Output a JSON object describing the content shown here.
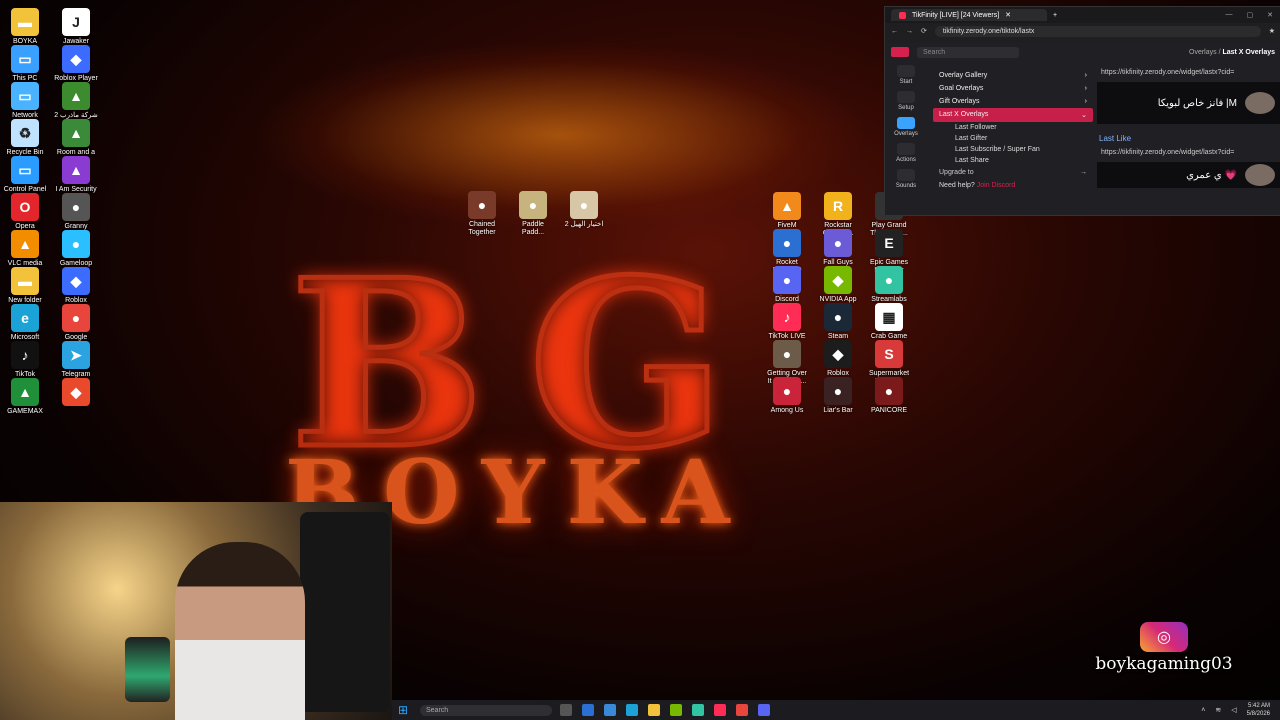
{
  "wallpaper": {
    "brand_letters": "BG",
    "brand_name": "BOYKA"
  },
  "desktop_icons_left": [
    {
      "label": "BOYKA",
      "color": "#f2c23b",
      "glyph": "▬"
    },
    {
      "label": "Jawaker",
      "color": "#ffffff",
      "glyph": "J"
    },
    {
      "label": "This PC",
      "color": "#3aa0ff",
      "glyph": "▭"
    },
    {
      "label": "Roblox Player",
      "color": "#3b6cff",
      "glyph": "◆"
    },
    {
      "label": "Network",
      "color": "#4ab3ff",
      "glyph": "▭"
    },
    {
      "label": "2 شركة ماذرب",
      "color": "#3c8b2f",
      "glyph": "▲"
    },
    {
      "label": "Recycle Bin",
      "color": "#bfe3ff",
      "glyph": "♻"
    },
    {
      "label": "Room and a\nHalf",
      "color": "#3a8a3a",
      "glyph": "▲"
    },
    {
      "label": "Control Panel",
      "color": "#2a9cff",
      "glyph": "▭"
    },
    {
      "label": "I Am Security",
      "color": "#8a3bd1",
      "glyph": "▲"
    },
    {
      "label": "Opera\nbrowser",
      "color": "#e3262b",
      "glyph": "O"
    },
    {
      "label": "Granny",
      "color": "#555555",
      "glyph": "●"
    },
    {
      "label": "VLC media\nplayer",
      "color": "#f28d00",
      "glyph": "▲"
    },
    {
      "label": "Gameloop",
      "color": "#2ac0ff",
      "glyph": "●"
    },
    {
      "label": "New folder",
      "color": "#f2c23b",
      "glyph": "▬"
    },
    {
      "label": "Roblox",
      "color": "#3b6cff",
      "glyph": "◆"
    },
    {
      "label": "Microsoft\nEdge",
      "color": "#1ba3d8",
      "glyph": "e"
    },
    {
      "label": "Google\nChrome",
      "color": "#e8453c",
      "glyph": "●"
    },
    {
      "label": "TikTok",
      "color": "#111111",
      "glyph": "♪"
    },
    {
      "label": "Telegram",
      "color": "#2aa3e0",
      "glyph": "➤"
    },
    {
      "label": "GAMEMAX",
      "color": "#1f8f3a",
      "glyph": "▲"
    },
    {
      "label": "",
      "color": "#e84a2b",
      "glyph": "◆"
    }
  ],
  "desktop_icons_center": [
    {
      "label": "Chained\nTogether",
      "color": "#7a3a2a",
      "glyph": "●"
    },
    {
      "label": "Paddle\nPadd...",
      "color": "#c7b37d",
      "glyph": "●"
    },
    {
      "label": "اختيار الهيل 2",
      "color": "#d7c7a7",
      "glyph": "●"
    }
  ],
  "desktop_icons_right": [
    {
      "label": "FiveM",
      "color": "#f28a1b",
      "glyph": "▲"
    },
    {
      "label": "Rockstar\nGames ...",
      "color": "#f2b21b",
      "glyph": "R"
    },
    {
      "label": "Play Grand\nTheft Auto...",
      "color": "#333333",
      "glyph": "V"
    },
    {
      "label": "Rocket\nLeague®",
      "color": "#2a6fd1",
      "glyph": "●"
    },
    {
      "label": "Fall Guys",
      "color": "#6b5bd6",
      "glyph": "●"
    },
    {
      "label": "Epic Games\nLauncher",
      "color": "#222222",
      "glyph": "E"
    },
    {
      "label": "Discord",
      "color": "#5865f2",
      "glyph": "●"
    },
    {
      "label": "NVIDIA App",
      "color": "#76b900",
      "glyph": "◆"
    },
    {
      "label": "Streamlabs\nDesktop",
      "color": "#31c3a2",
      "glyph": "●"
    },
    {
      "label": "TikTok LIVE\nStudio",
      "color": "#ff2d55",
      "glyph": "♪"
    },
    {
      "label": "Steam",
      "color": "#1b2838",
      "glyph": "●"
    },
    {
      "label": "Crab Game",
      "color": "#ffffff",
      "glyph": "▦"
    },
    {
      "label": "Getting Over\nIt with Ben...",
      "color": "#6b5b48",
      "glyph": "●"
    },
    {
      "label": "Roblox\nStudio",
      "color": "#1c1c1c",
      "glyph": "◆"
    },
    {
      "label": "Supermarket\nTogether",
      "color": "#d83a3a",
      "glyph": "S"
    },
    {
      "label": "Among Us",
      "color": "#c9243a",
      "glyph": "●"
    },
    {
      "label": "Liar's Bar",
      "color": "#3a2222",
      "glyph": "●"
    },
    {
      "label": "PANICORE",
      "color": "#7a1a1a",
      "glyph": "●"
    }
  ],
  "browser": {
    "tab_title": "TikFinity [LIVE] [24 Viewers]",
    "url": "tikfinity.zerody.one/tiktok/lastx",
    "app": {
      "search_placeholder": "Search",
      "crumb_parent": "Overlays",
      "crumb_current": "Last X Overlays",
      "nav": [
        {
          "label": "Start",
          "active": false
        },
        {
          "label": "Setup",
          "active": false
        },
        {
          "label": "Overlays",
          "active": true
        },
        {
          "label": "Actions",
          "active": false
        },
        {
          "label": "Sounds",
          "active": false
        }
      ],
      "menu": [
        {
          "label": "Overlay Gallery"
        },
        {
          "label": "Goal Overlays"
        },
        {
          "label": "Gift Overlays"
        }
      ],
      "active_menu": "Last X Overlays",
      "submenu": [
        "Last Follower",
        "Last Gifter",
        "Last Subscribe / Super Fan",
        "Last Share"
      ],
      "upgrade": "Upgrade to",
      "help": "Need help?",
      "help_link": "Join Discord",
      "widget_url_1": "https://tikfinity.zerody.one/widget/lastx?cid=",
      "widget_text_1": "فانز خاص لبويكا |M",
      "last_like_label": "Last Like",
      "widget_url_2": "https://tikfinity.zerody.one/widget/lastx?cid=",
      "widget_text_2": "ي عمري 💗"
    }
  },
  "instagram": {
    "handle": "boykagaming03"
  },
  "taskbar": {
    "search_placeholder": "Search",
    "time": "5:42 AM",
    "date": "5/8/2026"
  }
}
